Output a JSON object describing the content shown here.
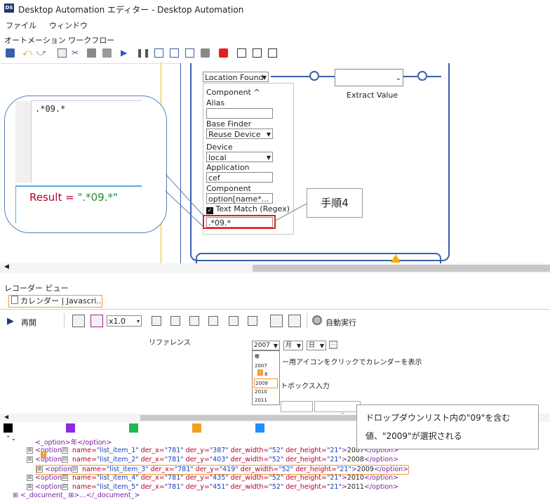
{
  "window": {
    "title": "Desktop Automation エディター - Desktop Automation",
    "logo_text": "DS"
  },
  "menu": {
    "file": "ファイル",
    "window": "ウィンドウ"
  },
  "workflow_label": "オートメーション ワークフロー",
  "step": {
    "header_select": "Location Found",
    "component_label": "Component",
    "alias_label": "Alias",
    "alias_value": "",
    "base_finder_label": "Base Finder",
    "base_finder_value": "Reuse Device",
    "device_label": "Device",
    "device_value": "local",
    "application_label": "Application",
    "application_value": "cef",
    "component2_label": "Component",
    "component2_value": "option[name*...",
    "text_match_label": "Text Match (Regex)",
    "text_match_checked": true,
    "regex_value": ".*09.*"
  },
  "extract_value_label": "Extract Value",
  "callout": {
    "editor_text": ".*09.*",
    "result_label": "Result = ",
    "result_value": "\".*09.*\""
  },
  "step_label": "手順4",
  "recorder": {
    "label": "レコーダー ビュー",
    "tab_label": "カレンダー | Javascri...",
    "replay_label": "再開",
    "speed_value": "x1.0",
    "auto_exec_label": "自動実行"
  },
  "preview": {
    "reference_label": "リファレンス",
    "year_value": "2007",
    "month_value": "月",
    "day_value": "日",
    "dropdown_header": "年",
    "dropdown_options": [
      "2007",
      "8",
      "2009",
      "2010",
      "2011"
    ],
    "hint_text": "ー用アイコンをクリックでカレンダーを表示",
    "textbox_text": "トボックス入力"
  },
  "tree_rows": [
    {
      "prefix": "<_option",
      "name": "",
      "rest": "",
      "text": ">年</option>",
      "partial": true
    },
    {
      "prefix": "<option",
      "name": "list_item_1",
      "x": "781",
      "y": "387",
      "w": "52",
      "h": "21",
      "text": "2007"
    },
    {
      "prefix": "<option",
      "name": "list_item_2",
      "x": "781",
      "y": "403",
      "w": "52",
      "h": "21",
      "text": "2008"
    },
    {
      "prefix": "<option",
      "name": "list_item_3",
      "x": "781",
      "y": "419",
      "w": "52",
      "h": "21",
      "text": "2009"
    },
    {
      "prefix": "<option",
      "name": "list_item_4",
      "x": "781",
      "y": "435",
      "w": "52",
      "h": "21",
      "text": "2010"
    },
    {
      "prefix": "<option",
      "name": "list_item_5",
      "x": "781",
      "y": "451",
      "w": "52",
      "h": "21",
      "text": "2011"
    }
  ],
  "tree_tail": "<_document_ ⊞>…</_document_>",
  "annotation": {
    "line1": "ドロップダウンリスト内の\"09\"を含む",
    "line2": "値、\"2009\"が選択される"
  },
  "swatch_colors": [
    "#000000",
    "#8a2be2",
    "#1fb84a",
    "#f5a01c",
    "#1e90ff"
  ],
  "accent_colors": {
    "highlight": "#e0201c",
    "orange": "#f29a2e",
    "blue": "#3a5fa8"
  }
}
